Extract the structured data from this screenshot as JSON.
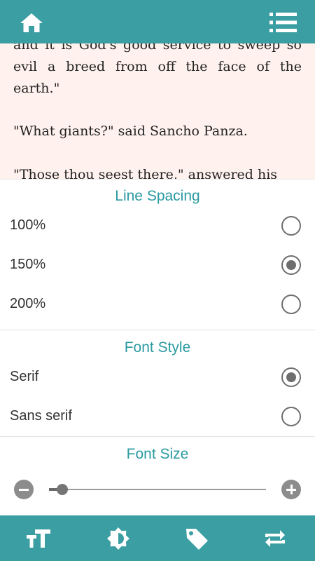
{
  "topbar": {
    "home_icon": "home-icon",
    "menu_icon": "list-menu-icon",
    "background": "#3a9ea2"
  },
  "reader": {
    "paragraphs": [
      "and it is God's good service to sweep so evil a breed from off the face of the earth.\"",
      "\"What giants?\" said Sancho Panza.",
      "\"Those thou seest there,\" answered his"
    ],
    "background": "#fff2ee"
  },
  "settings": {
    "line_spacing": {
      "title": "Line Spacing",
      "options": [
        {
          "label": "100%",
          "selected": false
        },
        {
          "label": "150%",
          "selected": true
        },
        {
          "label": "200%",
          "selected": false
        }
      ]
    },
    "font_style": {
      "title": "Font Style",
      "options": [
        {
          "label": "Serif",
          "selected": true
        },
        {
          "label": "Sans serif",
          "selected": false
        }
      ]
    },
    "font_size": {
      "title": "Font Size",
      "level": 0.06,
      "decrease_icon": "minus-circle-icon",
      "increase_icon": "plus-circle-icon"
    },
    "accent": "#2b9aa0"
  },
  "bottombar": {
    "icons": [
      "text-size-icon",
      "brightness-icon",
      "tag-icon",
      "repeat-icon"
    ]
  }
}
